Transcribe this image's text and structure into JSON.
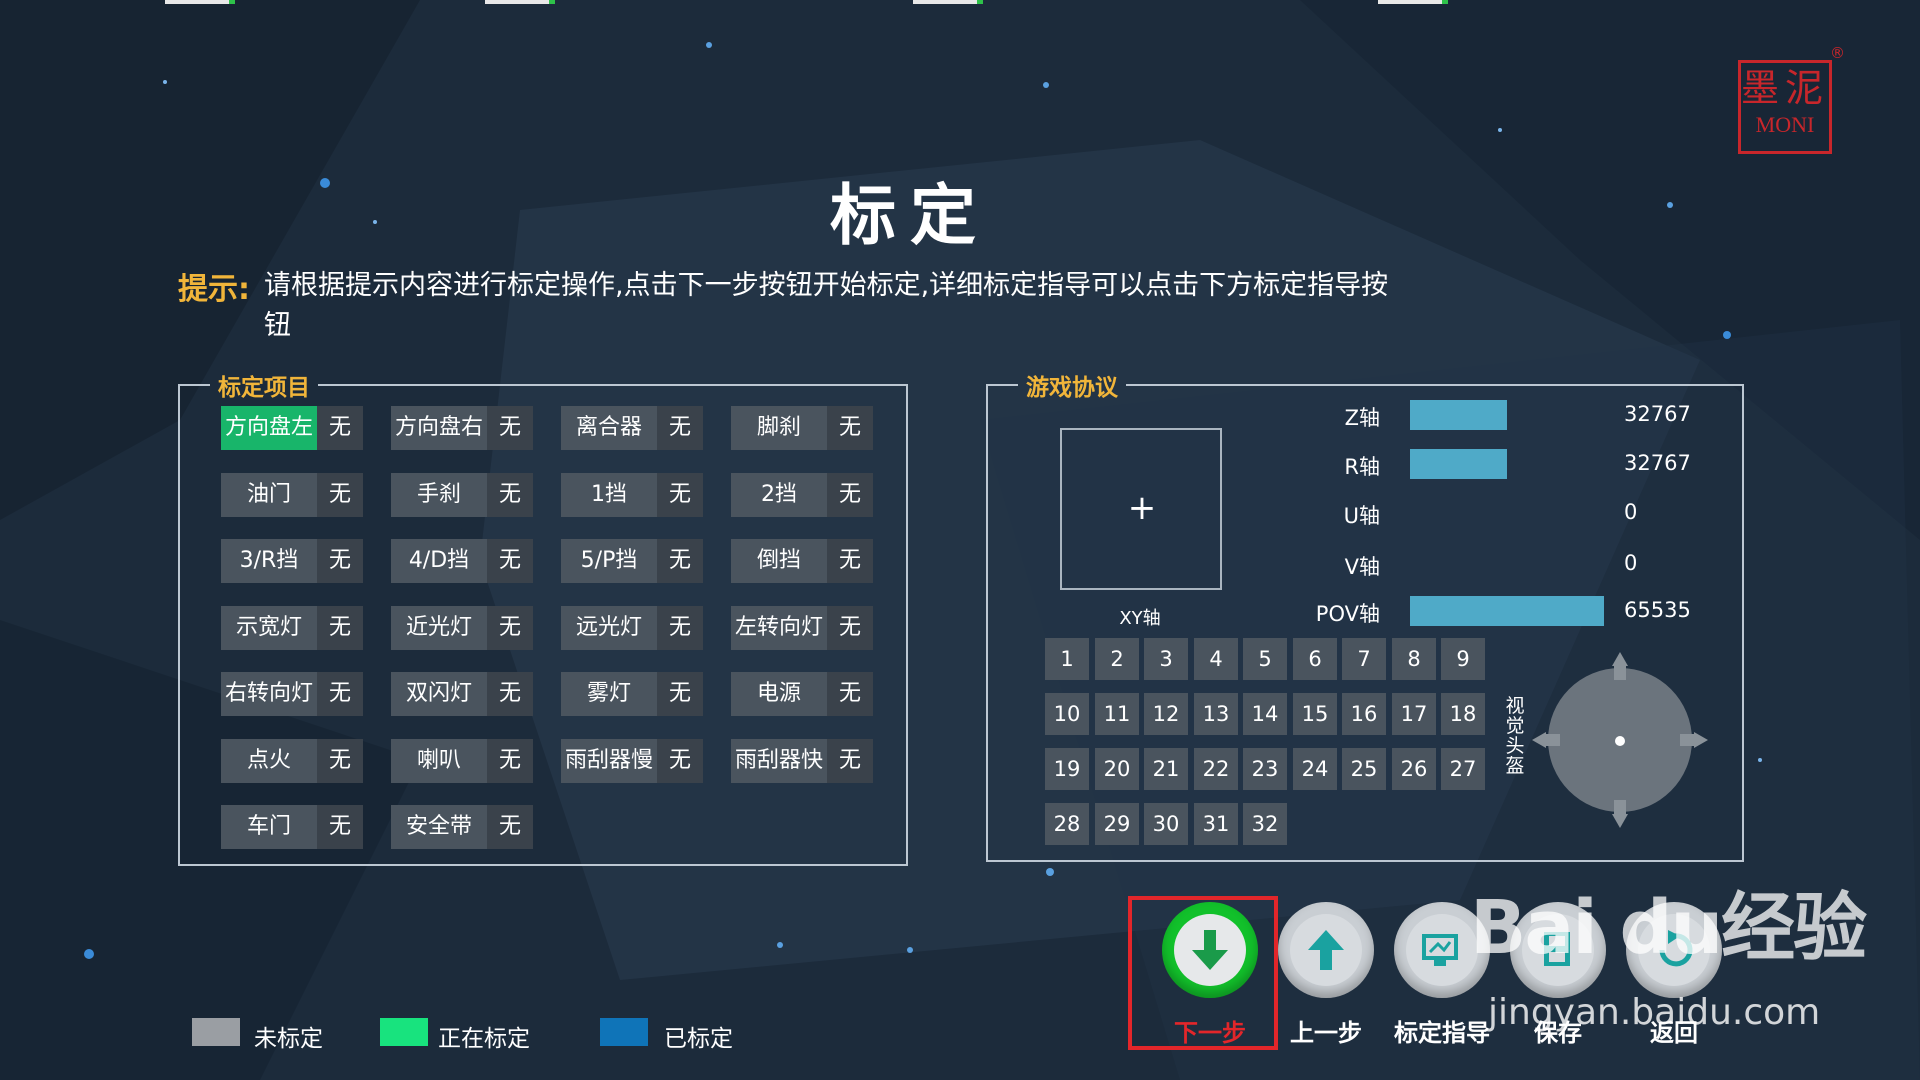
{
  "title": "标定",
  "logo": {
    "line1": "墨泥",
    "line2": "MONI",
    "registered": "®"
  },
  "hint": {
    "label": "提示:",
    "text": "请根据提示内容进行标定操作,点击下一步按钮开始标定,详细标定指导可以点击下方标定指导按钮"
  },
  "calib_panel": {
    "title": "标定项目",
    "items": [
      {
        "name": "方向盘左",
        "status": "无",
        "active": true
      },
      {
        "name": "方向盘右",
        "status": "无"
      },
      {
        "name": "离合器",
        "status": "无"
      },
      {
        "name": "脚刹",
        "status": "无"
      },
      {
        "name": "油门",
        "status": "无"
      },
      {
        "name": "手刹",
        "status": "无"
      },
      {
        "name": "1挡",
        "status": "无"
      },
      {
        "name": "2挡",
        "status": "无"
      },
      {
        "name": "3/R挡",
        "status": "无"
      },
      {
        "name": "4/D挡",
        "status": "无"
      },
      {
        "name": "5/P挡",
        "status": "无"
      },
      {
        "name": "倒挡",
        "status": "无"
      },
      {
        "name": "示宽灯",
        "status": "无"
      },
      {
        "name": "近光灯",
        "status": "无"
      },
      {
        "name": "远光灯",
        "status": "无"
      },
      {
        "name": "左转向灯",
        "status": "无"
      },
      {
        "name": "右转向灯",
        "status": "无"
      },
      {
        "name": "双闪灯",
        "status": "无"
      },
      {
        "name": "雾灯",
        "status": "无"
      },
      {
        "name": "电源",
        "status": "无"
      },
      {
        "name": "点火",
        "status": "无"
      },
      {
        "name": "喇叭",
        "status": "无"
      },
      {
        "name": "雨刮器慢",
        "status": "无"
      },
      {
        "name": "雨刮器快",
        "status": "无"
      },
      {
        "name": "车门",
        "status": "无"
      },
      {
        "name": "安全带",
        "status": "无"
      }
    ]
  },
  "protocol_panel": {
    "title": "游戏协议",
    "xy_label": "XY轴",
    "xy_cross": "+",
    "axes": [
      {
        "label": "Z轴",
        "value": "32767",
        "level": 0.5
      },
      {
        "label": "R轴",
        "value": "32767",
        "level": 0.5
      },
      {
        "label": "U轴",
        "value": "0",
        "level": 0
      },
      {
        "label": "V轴",
        "value": "0",
        "level": 0
      },
      {
        "label": "POV轴",
        "value": "65535",
        "level": 1
      }
    ],
    "buttons": [
      "1",
      "2",
      "3",
      "4",
      "5",
      "6",
      "7",
      "8",
      "9",
      "10",
      "11",
      "12",
      "13",
      "14",
      "15",
      "16",
      "17",
      "18",
      "19",
      "20",
      "21",
      "22",
      "23",
      "24",
      "25",
      "26",
      "27",
      "28",
      "29",
      "30",
      "31",
      "32"
    ],
    "hat_label": "视觉头盔"
  },
  "actions": [
    {
      "label": "下一步",
      "icon": "arrow-down-icon",
      "primary": true
    },
    {
      "label": "上一步",
      "icon": "arrow-up-icon"
    },
    {
      "label": "标定指导",
      "icon": "guide-icon"
    },
    {
      "label": "保存",
      "icon": "save-icon"
    },
    {
      "label": "返回",
      "icon": "return-icon"
    }
  ],
  "legend": [
    {
      "label": "未标定",
      "color": "#9a9ea3"
    },
    {
      "label": "正在标定",
      "color": "#18e37e"
    },
    {
      "label": "已标定",
      "color": "#0f74b8"
    }
  ],
  "watermark": {
    "text": "Bai du经验",
    "sub": "jingyan.baidu.com"
  },
  "colors": {
    "accent": "#f1b53a",
    "active": "#18b56a",
    "highlight": "#e3262a",
    "bar": "#4faac8"
  }
}
